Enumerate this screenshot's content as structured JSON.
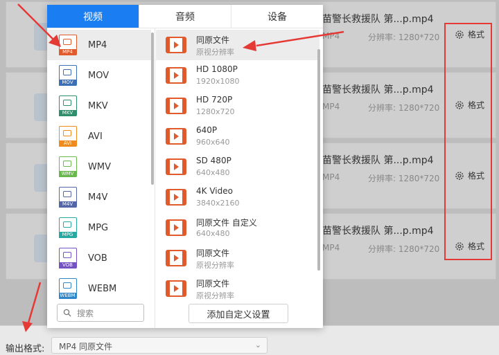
{
  "files": [
    {
      "name": "苗警长救援队 第...p.mp4",
      "format": "MP4",
      "resolution": "分辨率: 1280*720",
      "format_button": "格式"
    },
    {
      "name": "苗警长救援队 第...p.mp4",
      "format": "MP4",
      "resolution": "分辨率: 1280*720",
      "format_button": "格式"
    },
    {
      "name": "苗警长救援队 第...p.mp4",
      "format": "MP4",
      "resolution": "分辨率: 1280*720",
      "format_button": "格式"
    },
    {
      "name": "苗警长救援队 第...p.mp4",
      "format": "MP4",
      "resolution": "分辨率: 1280*720",
      "format_button": "格式"
    }
  ],
  "popup": {
    "tabs": [
      {
        "label": "视频",
        "active": true
      },
      {
        "label": "音频",
        "active": false
      },
      {
        "label": "设备",
        "active": false
      }
    ],
    "formats": [
      {
        "label": "MP4",
        "tag": "MP4",
        "color": "#e15a2b",
        "selected": true
      },
      {
        "label": "MOV",
        "tag": "MOV",
        "color": "#3b6fb6",
        "selected": false
      },
      {
        "label": "MKV",
        "tag": "MKV",
        "color": "#2f8f6a",
        "selected": false
      },
      {
        "label": "AVI",
        "tag": "AVI",
        "color": "#ef8a1c",
        "selected": false
      },
      {
        "label": "WMV",
        "tag": "WMV",
        "color": "#68b84d",
        "selected": false
      },
      {
        "label": "M4V",
        "tag": "M4V",
        "color": "#5465a8",
        "selected": false
      },
      {
        "label": "MPG",
        "tag": "MPG",
        "color": "#25a9a0",
        "selected": false
      },
      {
        "label": "VOB",
        "tag": "VOB",
        "color": "#7352c2",
        "selected": false
      },
      {
        "label": "WEBM",
        "tag": "WEBM",
        "color": "#2f86c9",
        "selected": false
      }
    ],
    "search_placeholder": "搜索",
    "presets": [
      {
        "title": "同原文件",
        "sub": "原视分辨率",
        "selected": true
      },
      {
        "title": "HD 1080P",
        "sub": "1920x1080",
        "selected": false
      },
      {
        "title": "HD 720P",
        "sub": "1280x720",
        "selected": false
      },
      {
        "title": "640P",
        "sub": "960x640",
        "selected": false
      },
      {
        "title": "SD 480P",
        "sub": "640x480",
        "selected": false
      },
      {
        "title": "4K Video",
        "sub": "3840x2160",
        "selected": false
      },
      {
        "title": "同原文件 自定义",
        "sub": "640x480",
        "selected": false
      },
      {
        "title": "同原文件",
        "sub": "原视分辨率",
        "selected": false
      },
      {
        "title": "同原文件",
        "sub": "原视分辨率",
        "selected": false
      }
    ],
    "add_custom_label": "添加自定义设置"
  },
  "bottom": {
    "output_label": "输出格式:",
    "output_value": "MP4   同原文件"
  },
  "colors": {
    "accent": "#1a7ef2",
    "annotation": "#e53935",
    "film": "#e15a2b"
  }
}
